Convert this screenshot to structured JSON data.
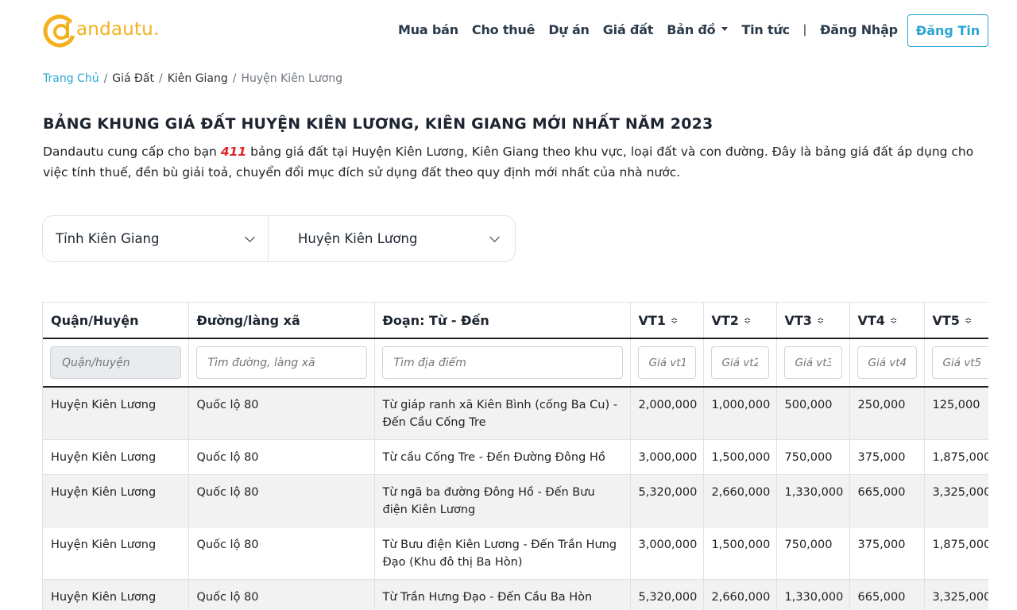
{
  "header": {
    "logo_text": "andautu.",
    "nav": [
      "Mua bán",
      "Cho thuê",
      "Dự án",
      "Giá đất",
      "Bản đồ",
      "Tin tức"
    ],
    "separator": "|",
    "login_label": "Đăng Nhập",
    "post_label": "Đăng Tin",
    "brand_color": "#f4b11d",
    "accent_color": "#2aa6d4"
  },
  "breadcrumb": {
    "home": "Trang Chủ",
    "level2": "Giá Đất",
    "level3": "Kiên Giang",
    "current": "Huyện Kiên Lương"
  },
  "title": "BẢNG KHUNG GIÁ ĐẤT HUYỆN KIÊN LƯƠNG, KIÊN GIANG MỚI NHẤT NĂM 2023",
  "intro": {
    "prefix": "Dandautu cung cấp cho bạn ",
    "count": "411",
    "suffix": " bảng giá đất tại Huyện Kiên Lương, Kiên Giang theo khu vực, loại đất và con đường. Đây là bảng giá đất áp dụng cho việc tính thuế, đền bù giải toả, chuyển đổi mục đích sử dụng đất theo quy định mới nhất của nhà nước."
  },
  "filters": {
    "province": "Tỉnh Kiên Giang",
    "district": "Huyện Kiên Lương"
  },
  "table": {
    "columns": [
      "Quận/Huyện",
      "Đường/làng xã",
      "Đoạn: Từ - Đến",
      "VT1",
      "VT2",
      "VT3",
      "VT4",
      "VT5"
    ],
    "placeholders": [
      "Quận/huyện",
      "Tìm đường, làng xã",
      "Tìm địa điểm",
      "Giá vt1",
      "Giá vt2",
      "Giá vt3",
      "Giá vt4",
      "Giá vt5"
    ],
    "rows": [
      [
        "Huyện Kiên Lương",
        "Quốc lộ 80",
        "Từ giáp ranh xã Kiên Bình (cống Ba Cu) - Đến Cầu Cống Tre",
        "2,000,000",
        "1,000,000",
        "500,000",
        "250,000",
        "125,000"
      ],
      [
        "Huyện Kiên Lương",
        "Quốc lộ 80",
        "Từ cầu Cống Tre - Đến Đường Đông Hồ",
        "3,000,000",
        "1,500,000",
        "750,000",
        "375,000",
        "1,875,000"
      ],
      [
        "Huyện Kiên Lương",
        "Quốc lộ 80",
        "Từ ngã ba đường Đông Hồ - Đến Bưu điện Kiên Lương",
        "5,320,000",
        "2,660,000",
        "1,330,000",
        "665,000",
        "3,325,000"
      ],
      [
        "Huyện Kiên Lương",
        "Quốc lộ 80",
        "Từ Bưu điện Kiên Lương - Đến Trần Hưng Đạo (Khu đô thị Ba Hòn)",
        "3,000,000",
        "1,500,000",
        "750,000",
        "375,000",
        "1,875,000"
      ],
      [
        "Huyện Kiên Lương",
        "Quốc lộ 80",
        "Từ Trần Hưng Đạo - Đến Cầu Ba Hòn",
        "5,320,000",
        "2,660,000",
        "1,330,000",
        "665,000",
        "3,325,000"
      ],
      [
        "",
        "",
        "",
        "",
        "",
        "",
        "",
        ""
      ]
    ]
  }
}
